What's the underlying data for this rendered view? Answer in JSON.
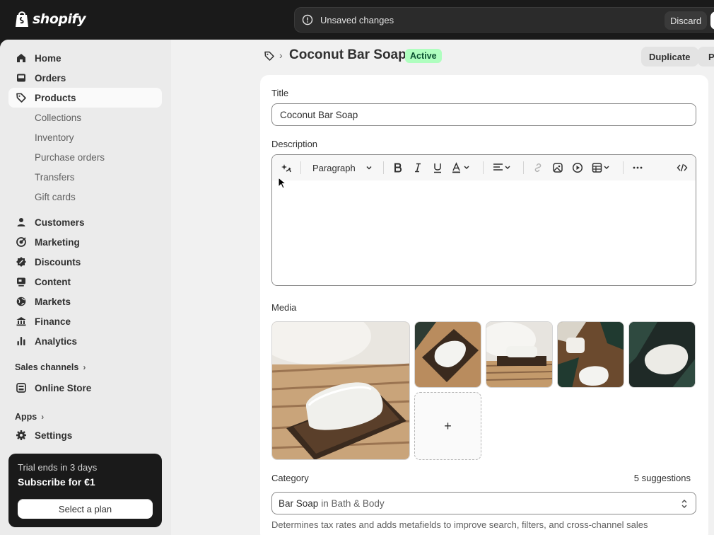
{
  "brand": {
    "name": "shopify"
  },
  "topbar": {
    "unsaved_text": "Unsaved changes",
    "discard_label": "Discard",
    "save_label": ""
  },
  "sidebar": {
    "primary": [
      {
        "label": "Home",
        "icon": "home-icon"
      },
      {
        "label": "Orders",
        "icon": "inbox-icon"
      },
      {
        "label": "Products",
        "icon": "tag-icon",
        "active": true
      }
    ],
    "product_subitems": [
      "Collections",
      "Inventory",
      "Purchase orders",
      "Transfers",
      "Gift cards"
    ],
    "secondary": [
      {
        "label": "Customers",
        "icon": "person-icon"
      },
      {
        "label": "Marketing",
        "icon": "target-icon"
      },
      {
        "label": "Discounts",
        "icon": "discount-icon"
      },
      {
        "label": "Content",
        "icon": "content-icon"
      },
      {
        "label": "Markets",
        "icon": "globe-icon"
      },
      {
        "label": "Finance",
        "icon": "bank-icon"
      },
      {
        "label": "Analytics",
        "icon": "bar-chart-icon"
      }
    ],
    "sales_channels_label": "Sales channels",
    "online_store_label": "Online Store",
    "apps_label": "Apps",
    "settings_label": "Settings",
    "trial": {
      "text": "Trial ends in 3 days",
      "subtitle": "Subscribe for €1",
      "button_label": "Select a plan"
    }
  },
  "header": {
    "title": "Coconut Bar Soap",
    "status": "Active",
    "duplicate_label": "Duplicate",
    "more_label": "P"
  },
  "form": {
    "title_label": "Title",
    "title_value": "Coconut Bar Soap",
    "description_label": "Description",
    "paragraph_select": "Paragraph",
    "media_label": "Media",
    "add_media_symbol": "+",
    "category_label": "Category",
    "suggestions": "5 suggestions",
    "category_value": "Bar Soap",
    "category_path": "in Bath & Body",
    "category_help": "Determines tax rates and adds metafields to improve search, filters, and cross-channel sales"
  },
  "colors": {
    "topbar_bg": "#1a1a1a",
    "sidebar_bg": "#ebebeb",
    "active_badge_bg": "#affebf",
    "active_badge_text": "#0c5132"
  }
}
